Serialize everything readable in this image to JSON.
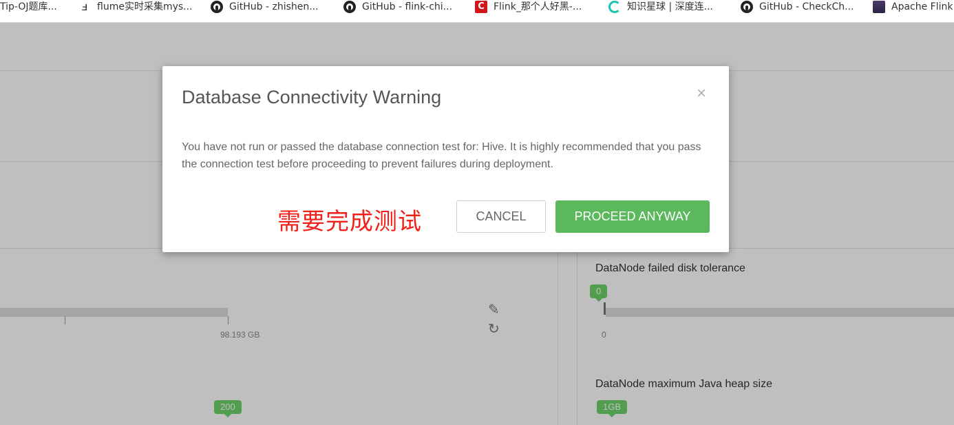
{
  "bookmarks": [
    {
      "label": "Tip-OJ题库...",
      "icon": "page-icon"
    },
    {
      "label": "flume实时采集mys...",
      "icon": "bookmark-icon"
    },
    {
      "label": "GitHub - zhishen...",
      "icon": "github-icon"
    },
    {
      "label": "GitHub - flink-chi...",
      "icon": "github-icon"
    },
    {
      "label": "Flink_那个人好黑-...",
      "icon": "csdn-icon"
    },
    {
      "label": "知识星球 | 深度连...",
      "icon": "zsxq-icon"
    },
    {
      "label": "GitHub - CheckCh...",
      "icon": "github-icon"
    },
    {
      "label": "Apache Flink",
      "icon": "avatar-icon"
    }
  ],
  "background": {
    "slider_max_label": "98.193 GB",
    "bubble_200": "200",
    "failed_disk_label": "DataNode failed disk tolerance",
    "failed_disk_value": "0",
    "failed_disk_min": "0",
    "heap_label": "DataNode maximum Java heap size",
    "heap_value": "1GB"
  },
  "modal": {
    "title": "Database Connectivity Warning",
    "close_glyph": "×",
    "body": "You have not run or passed the database connection test for: Hive. It is highly recommended that you pass the connection test before proceeding to prevent failures during deployment.",
    "annotation": "需要完成测试",
    "cancel_label": "CANCEL",
    "proceed_label": "PROCEED ANYWAY"
  },
  "colors": {
    "proceed": "#5cb85c",
    "annotation": "#f2201b",
    "bubble": "#6fd26a"
  }
}
